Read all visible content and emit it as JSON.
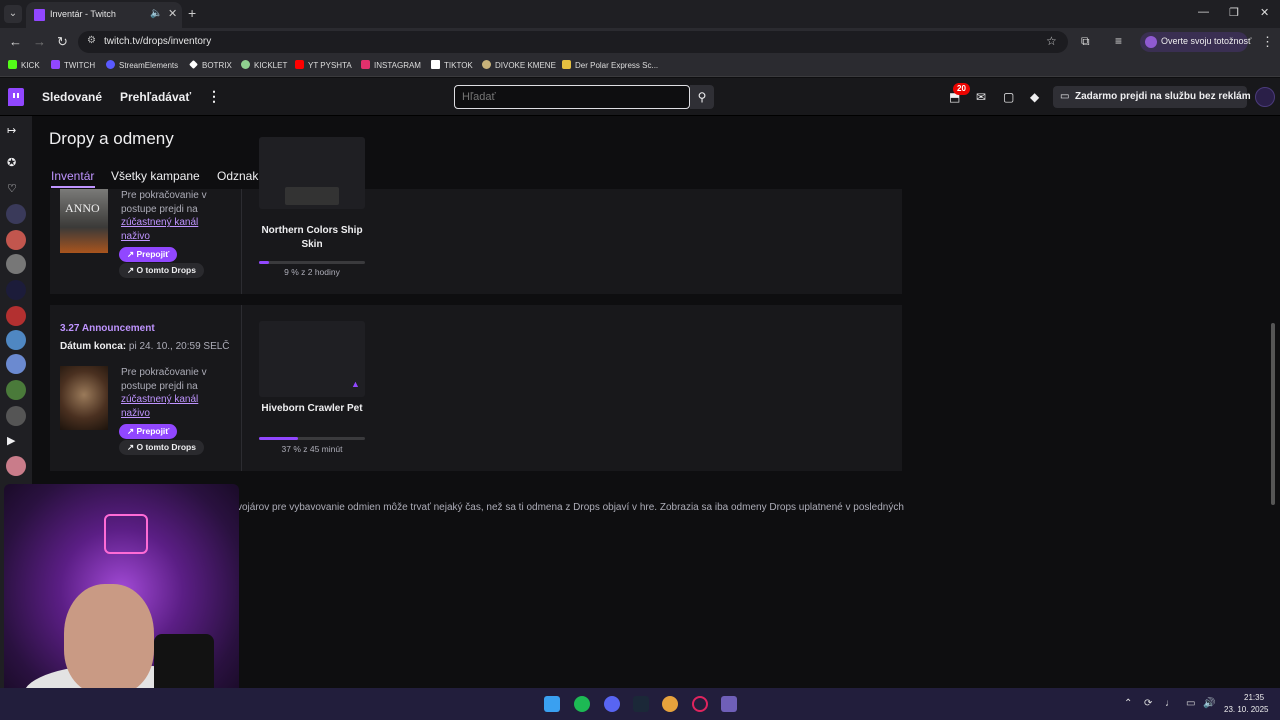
{
  "browser": {
    "tab_title": "Inventár - Twitch",
    "url": "twitch.tv/drops/inventory",
    "verify_label": "Overte svoju totožnosť",
    "bookmarks": [
      {
        "label": "KICK",
        "color": "#53fc18"
      },
      {
        "label": "TWITCH",
        "color": "#9147ff"
      },
      {
        "label": "StreamElements",
        "color": "#5a5aff"
      },
      {
        "label": "BOTRIX",
        "color": "#ffffff"
      },
      {
        "label": "KICKLET",
        "color": "#8fd18f"
      },
      {
        "label": "YT PYSHTA",
        "color": "#ff0000"
      },
      {
        "label": "INSTAGRAM",
        "color": "#e1306c"
      },
      {
        "label": "TIKTOK",
        "color": "#ffffff"
      },
      {
        "label": "DIVOKE KMENE",
        "color": "#c7b27a"
      },
      {
        "label": "Der Polar Express Sc...",
        "color": "#e5c040"
      }
    ]
  },
  "twitch_nav": {
    "following": "Sledované",
    "browse": "Prehľadávať",
    "search_placeholder": "Hľadať",
    "notif_count": "20",
    "ad_free_label": "Zadarmo prejdi na službu bez reklám"
  },
  "page": {
    "title": "Dropy a odmeny",
    "tabs": [
      "Inventár",
      "Všetky kampane",
      "Odznak sociálnych sietí"
    ],
    "footer_note": "vojárov pre vybavovanie odmien môže trvať nejaký čas, než sa ti odmena z Drops objaví v hre. Zobrazia sa iba odmeny Drops uplatnené v posledných"
  },
  "campaigns": [
    {
      "game_image_text": "ANNO",
      "desc_prefix": "Pre pokračovanie v postupe prejdi na",
      "desc_link": "zúčastnený kanál naživo",
      "link_button": "Prepojiť",
      "about_button": "O tomto Drops",
      "reward_name": "Northern Colors Ship Skin",
      "progress": 0.09,
      "progress_text": "9 % z 2 hodiny"
    },
    {
      "title": "3.27 Announcement",
      "end_label": "Dátum konca:",
      "end_value": "pi 24. 10., 20:59 SELČ",
      "desc_prefix": "Pre pokračovanie v postupe prejdi na",
      "desc_link": "zúčastnený kanál naživo",
      "link_button": "Prepojiť",
      "about_button": "O tomto Drops",
      "reward_name": "Hiveborn Crawler Pet",
      "progress": 0.37,
      "progress_text": "37 % z 45 minút"
    }
  ],
  "taskbar": {
    "time": "21:35",
    "date": "23. 10. 2025"
  }
}
